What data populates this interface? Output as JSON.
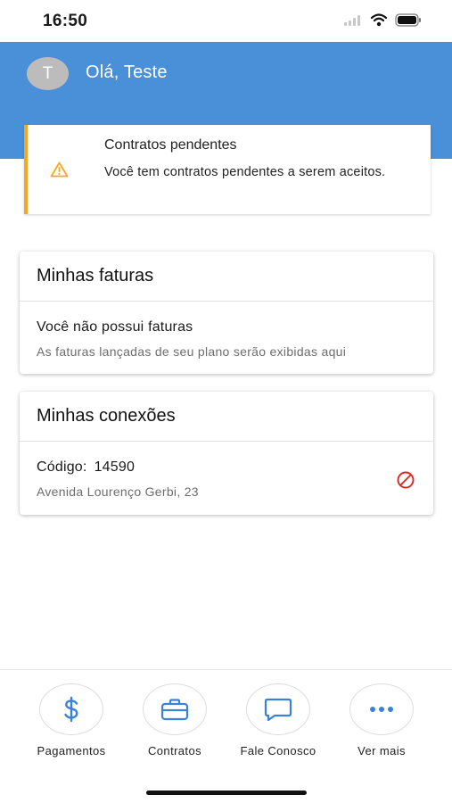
{
  "status": {
    "time": "16:50"
  },
  "header": {
    "avatar_initial": "T",
    "greeting": "Olá, Teste",
    "color": "#4a90d9"
  },
  "alert": {
    "icon": "warning-icon",
    "title": "Contratos pendentes",
    "text": "Você tem contratos pendentes a serem aceitos.",
    "accent": "#f5a623"
  },
  "faturas": {
    "title": "Minhas faturas",
    "empty_title": "Você não possui faturas",
    "empty_subtitle": "As faturas lançadas de seu plano serão exibidas aqui"
  },
  "conexoes": {
    "title": "Minhas conexões",
    "code_label": "Código:",
    "code_value": "14590",
    "address": "Avenida Lourenço Gerbi, 23",
    "status_icon": "blocked-icon",
    "status_color": "#e02424"
  },
  "nav": {
    "items": [
      {
        "label": "Pagamentos",
        "icon": "dollar-icon"
      },
      {
        "label": "Contratos",
        "icon": "briefcase-icon"
      },
      {
        "label": "Fale Conosco",
        "icon": "chat-icon"
      },
      {
        "label": "Ver mais",
        "icon": "more-icon"
      }
    ],
    "icon_color": "#3b82d6"
  }
}
